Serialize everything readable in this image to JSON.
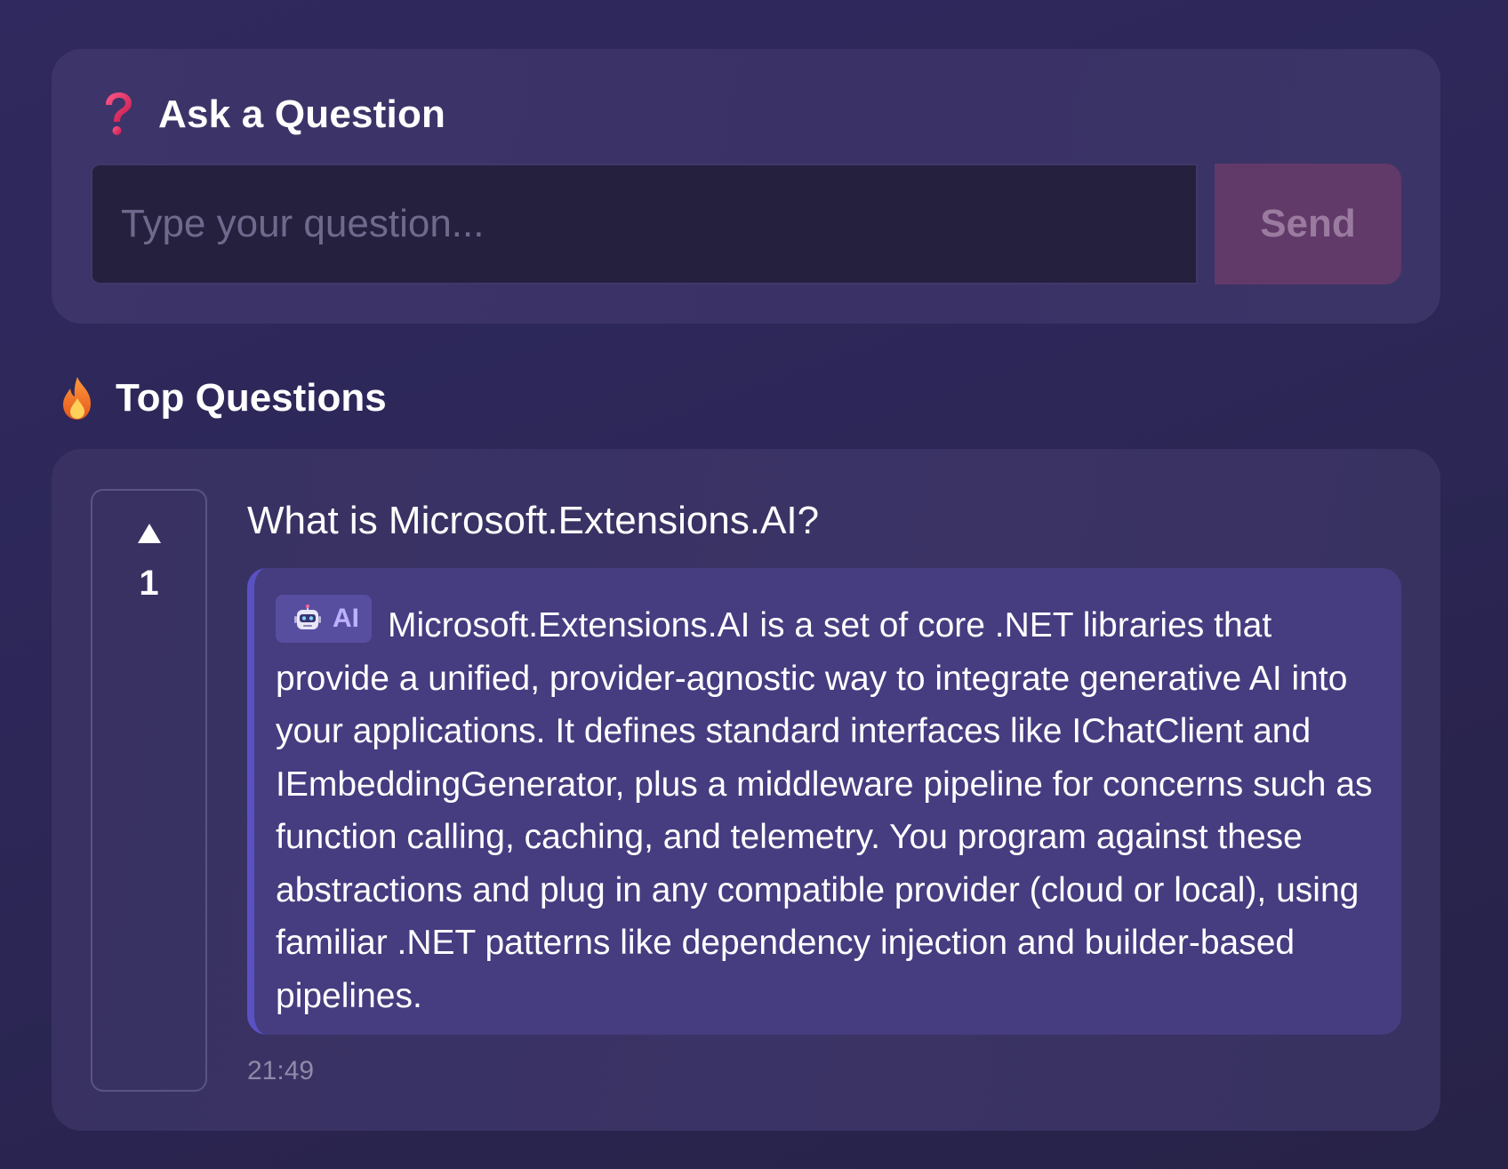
{
  "ask": {
    "title": "Ask a Question",
    "icon": "question-mark-icon",
    "input_placeholder": "Type your question...",
    "input_value": "",
    "send_label": "Send"
  },
  "top_questions": {
    "title": "Top Questions",
    "icon": "fire-icon",
    "items": [
      {
        "votes": "1",
        "question": "What is Microsoft.Extensions.AI?",
        "answer_badge": "AI",
        "answer": "Microsoft.Extensions.AI is a set of core .NET libraries that provide a unified, provider-agnostic way to integrate generative AI into your applications. It defines standard interfaces like IChatClient and IEmbeddingGenerator, plus a middleware pipeline for concerns such as function calling, caching, and telemetry. You program against these abstractions and plug in any compatible provider (cloud or local), using familiar .NET patterns like dependency injection and builder-based pipelines.",
        "time": "21:49"
      }
    ]
  },
  "colors": {
    "background": "#2c2757",
    "card": "#3b3467",
    "input_background": "#26203f",
    "send_button": "#613a69",
    "answer_background": "#463c80",
    "answer_accent": "#5a52c2",
    "ai_badge_text": "#bcb2ff"
  }
}
